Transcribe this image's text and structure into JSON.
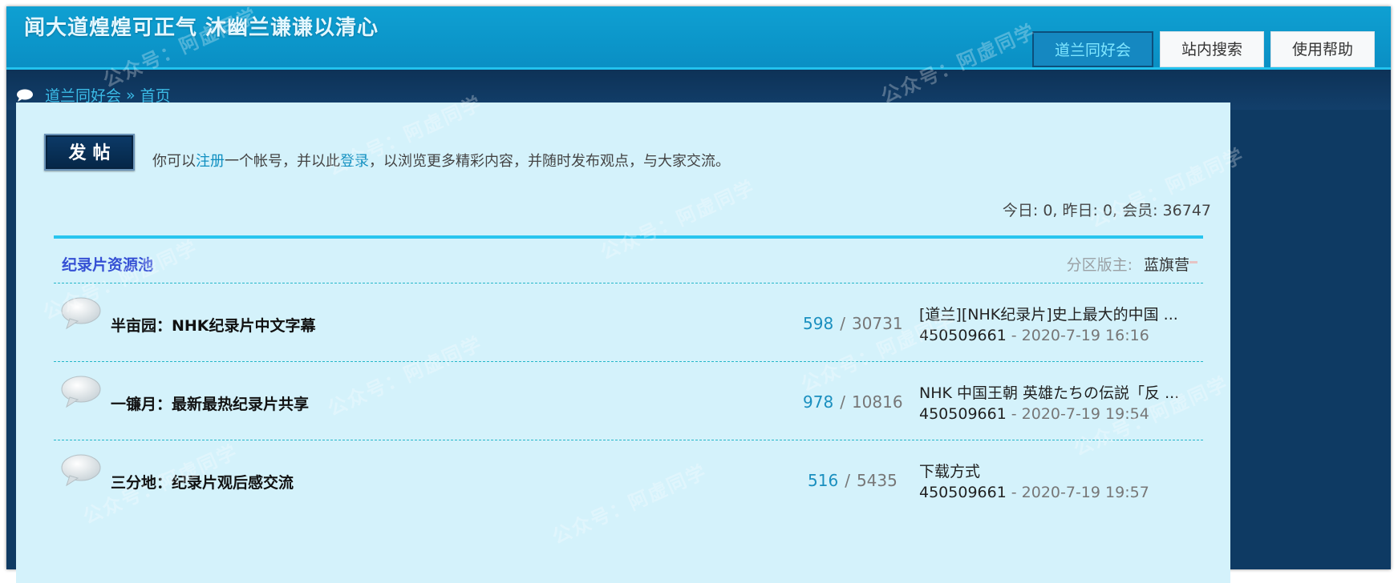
{
  "header": {
    "site_title": "闻大道煌煌可正气 沐幽兰谦谦以清心",
    "nav": [
      {
        "label": "道兰同好会",
        "active": true
      },
      {
        "label": "站内搜索",
        "active": false
      },
      {
        "label": "使用帮助",
        "active": false
      }
    ]
  },
  "breadcrumb": {
    "forum": "道兰同好会",
    "separator": "»",
    "home": "首页"
  },
  "actions": {
    "post_button": "发帖"
  },
  "intro": {
    "prefix": "你可以",
    "register": "注册",
    "middle": "一个帐号，并以此",
    "login": "登录",
    "suffix": "，以浏览更多精彩内容，并随时发布观点，与大家交流。"
  },
  "stats": {
    "text": "今日: 0, 昨日: 0, 会员: 36747"
  },
  "category": {
    "title": "纪录片资源池",
    "moderator_label": "分区版主:",
    "moderator_name": "蓝旗营"
  },
  "forums": [
    {
      "name": "半亩园：NHK纪录片中文字幕",
      "threads": "598",
      "posts": "30731",
      "last_title": "[道兰][NHK纪录片]史上最大的中国 ...",
      "last_user": "450509661",
      "last_time": "2020-7-19 16:16"
    },
    {
      "name": "一镰月：最新最热纪录片共享",
      "threads": "978",
      "posts": "10816",
      "last_title": "NHK 中国王朝 英雄たちの伝説「反 ...",
      "last_user": "450509661",
      "last_time": "2020-7-19 19:54"
    },
    {
      "name": "三分地：纪录片观后感交流",
      "threads": "516",
      "posts": "5435",
      "last_title": "下载方式",
      "last_user": "450509661",
      "last_time": "2020-7-19 19:57"
    }
  ],
  "watermark": "公众号：阿虚同学",
  "colors": {
    "header_bg": "#0a8fc4",
    "content_bg": "#d4f2fb",
    "link": "#0f8fc0",
    "category_title": "#3550d4",
    "rule": "#29c5ef"
  }
}
